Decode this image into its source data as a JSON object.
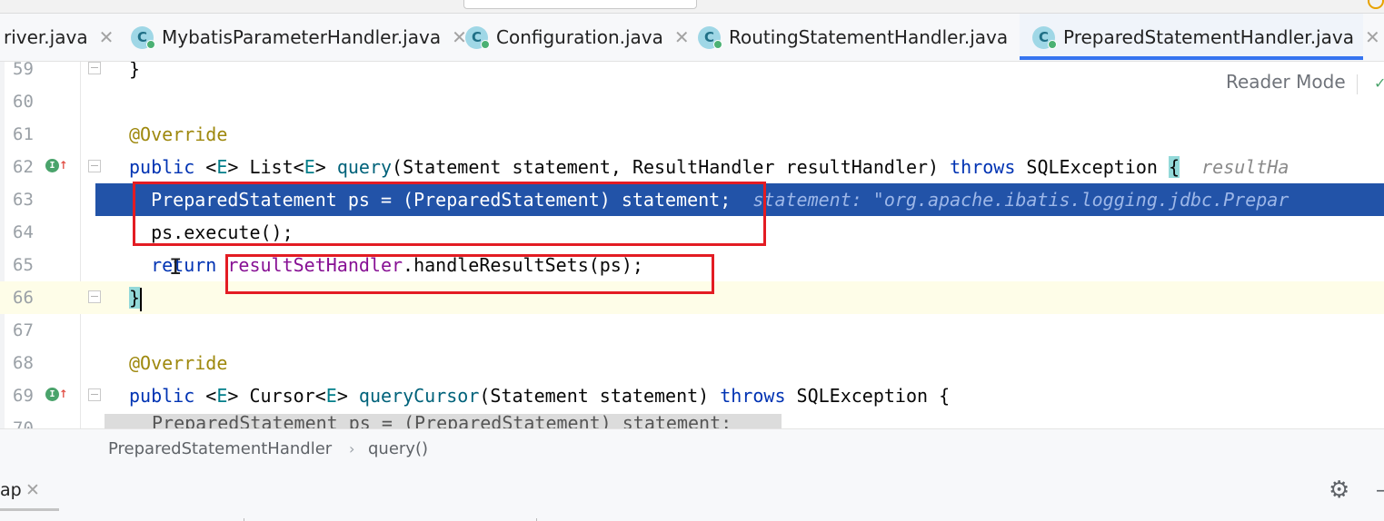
{
  "tabs": [
    {
      "label": "river.java",
      "icon": "",
      "active": false
    },
    {
      "label": "MybatisParameterHandler.java",
      "icon": "C",
      "active": false
    },
    {
      "label": "Configuration.java",
      "icon": "C",
      "active": false
    },
    {
      "label": "RoutingStatementHandler.java",
      "icon": "C",
      "active": false
    },
    {
      "label": "PreparedStatementHandler.java",
      "icon": "C",
      "active": true
    }
  ],
  "tab_close_glyph": "✕",
  "editor": {
    "reader_mode_label": "Reader Mode",
    "line_numbers": {
      "l59": "59",
      "l60": "60",
      "l61": "61",
      "l62": "62",
      "l63": "63",
      "l64": "64",
      "l65": "65",
      "l66": "66",
      "l67": "67",
      "l68": "68",
      "l69": "69",
      "l70": "70"
    },
    "code": {
      "l59_brace": "}",
      "l61_annotation": "@Override",
      "l62": {
        "kw_public": "public",
        "generic_open": " <",
        "E": "E",
        "generic_close": "> List<",
        "E2": "E",
        "after_list": "> ",
        "method": "query",
        "params": "(Statement statement, ResultHandler resultHandler) ",
        "kw_throws": "throws",
        "exc": " SQLException ",
        "brace": "{",
        "hint": "resultHa"
      },
      "l63": {
        "code": "  PreparedStatement ps = (PreparedStatement) statement;",
        "hint": "statement: \"org.apache.ibatis.logging.jdbc.Prepar"
      },
      "l64": "  ps.execute();",
      "l65": {
        "kw_return": "  return ",
        "field": "resultSetHandler",
        "rest": ".handleResultSets(ps);"
      },
      "l66_brace": "}",
      "l68_annotation": "@Override",
      "l69": {
        "kw_public": "public",
        "generic_open": " <",
        "E": "E",
        "generic_close": "> Cursor<",
        "E2": "E",
        "after_cursor": "> ",
        "method": "queryCursor",
        "params": "(Statement statement) ",
        "kw_throws": "throws",
        "exc": " SQLException {"
      },
      "l70_partial": "PreparedStatement ps = (PreparedStatement) statement;"
    }
  },
  "breadcrumb": {
    "class_name": "PreparedStatementHandler",
    "separator": "›",
    "method_name": "query()"
  },
  "bottom_panel": {
    "tab_label": "ap",
    "close_glyph": "✕"
  },
  "icons": {
    "file_icon": "C",
    "override_icon": "I",
    "override_arrow": "↑",
    "settings": "gear-icon",
    "minimize": "minus-icon"
  },
  "colors": {
    "selection": "#2253a8",
    "active_tab_underline": "#3574f0",
    "annotation_box": "#e31c23",
    "keyword": "#0033b3",
    "annotation": "#9e880d"
  }
}
